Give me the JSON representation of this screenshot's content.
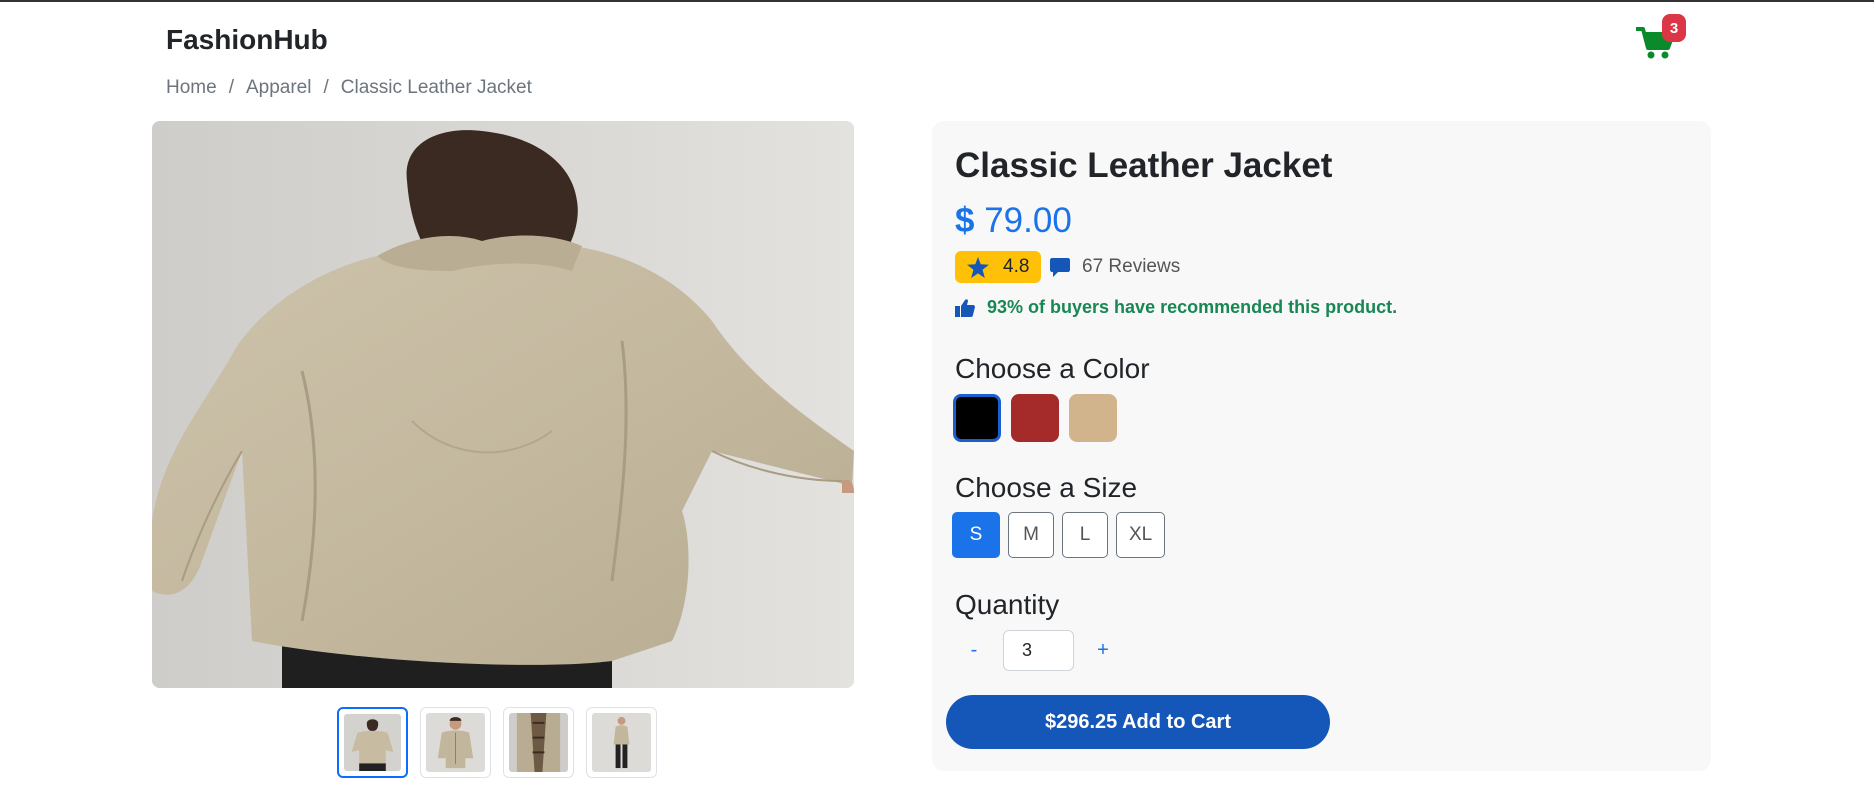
{
  "brand": "FashionHub",
  "cart": {
    "count": "3"
  },
  "breadcrumb": {
    "home": "Home",
    "category": "Apparel",
    "current": "Classic Leather Jacket",
    "separator": "/"
  },
  "gallery": {
    "thumbnail_count": 4,
    "active_index": 0
  },
  "product": {
    "title": "Classic Leather Jacket",
    "price_currency": "$",
    "price_amount": "79.00",
    "rating": "4.8",
    "reviews": "67 Reviews",
    "recommendation": "93% of buyers have recommended this product."
  },
  "color_section": {
    "label": "Choose a Color",
    "options": [
      "#000000",
      "#a52a2a",
      "#d2b48c"
    ],
    "selected": 0
  },
  "size_section": {
    "label": "Choose a Size",
    "options": [
      "S",
      "M",
      "L",
      "XL"
    ],
    "selected": "S"
  },
  "quantity_section": {
    "label": "Quantity",
    "decrement": "-",
    "increment": "+",
    "value": "3"
  },
  "add_to_cart": {
    "label": "$296.25 Add to Cart"
  },
  "colors": {
    "accent": "#1a73e8",
    "button": "#1557b8",
    "badge": "#dc3545",
    "success": "#198754",
    "rating_bg": "#ffc107"
  }
}
